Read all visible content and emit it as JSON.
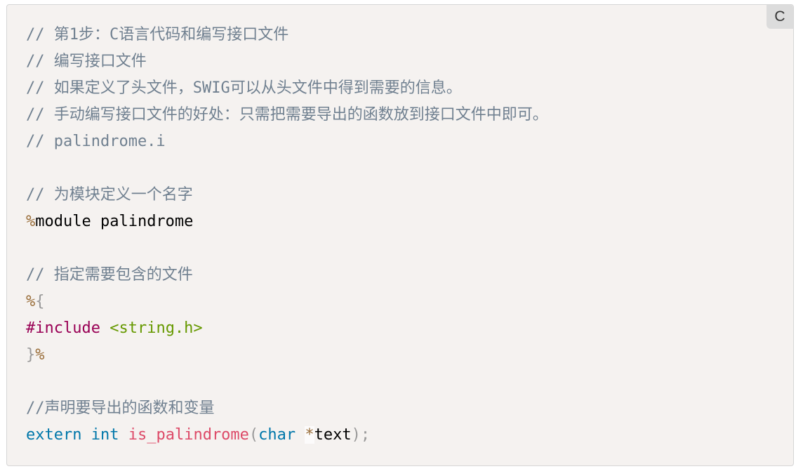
{
  "language_badge": "C",
  "code": {
    "comment_lines": [
      "// 第1步：C语言代码和编写接口文件",
      "// 编写接口文件",
      "// 如果定义了头文件，SWIG可以从头文件中得到需要的信息。",
      "// 手动编写接口文件的好处：只需把需要导出的函数放到接口文件中即可。",
      "// palindrome.i"
    ],
    "module_comment": "// 为模块定义一个名字",
    "module_directive": {
      "percent": "%",
      "text": "module palindrome"
    },
    "include_comment": "// 指定需要包含的文件",
    "block_open": {
      "percent": "%",
      "brace": "{"
    },
    "include_line": {
      "directive": "#include",
      "header": "<string.h>"
    },
    "block_close": {
      "brace": "}",
      "percent": "%"
    },
    "declare_comment": "//声明要导出的函数和变量",
    "declaration": {
      "extern": "extern",
      "int": "int",
      "function": "is_palindrome",
      "open_paren": "(",
      "char": "char",
      "star": "*",
      "param": "text",
      "close": ");"
    }
  }
}
